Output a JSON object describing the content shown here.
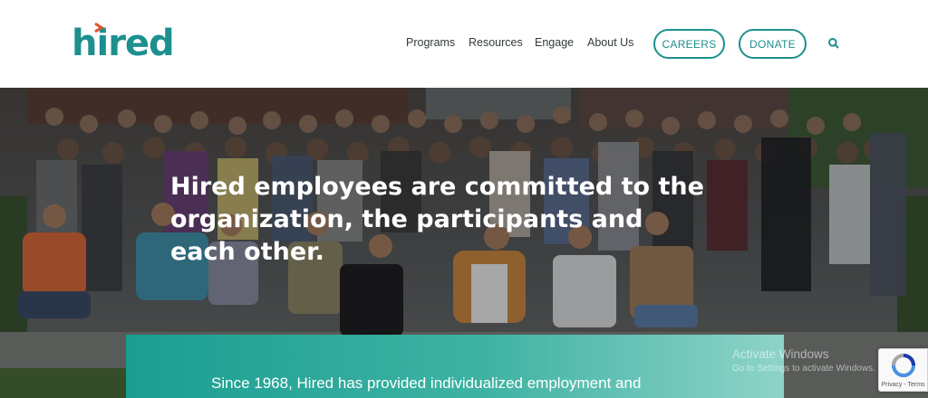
{
  "brand": {
    "logo_text": "hired",
    "color": "#1e8f8f",
    "accent": "#d9542b"
  },
  "nav": {
    "items": [
      "Programs",
      "Resources",
      "Engage",
      "About Us"
    ],
    "careers_label": "CAREERS",
    "donate_label": "DONATE",
    "search_icon": "search-icon"
  },
  "hero": {
    "headline": "Hired employees are committed to the organization, the participants and each other.",
    "subtext": "Since 1968, Hired has provided individualized employment and",
    "photo": "group-photo"
  },
  "overlay": {
    "activate_title": "Activate Windows",
    "activate_sub": "Go to Settings to activate Windows.",
    "recaptcha_label": "Privacy - Terms"
  }
}
